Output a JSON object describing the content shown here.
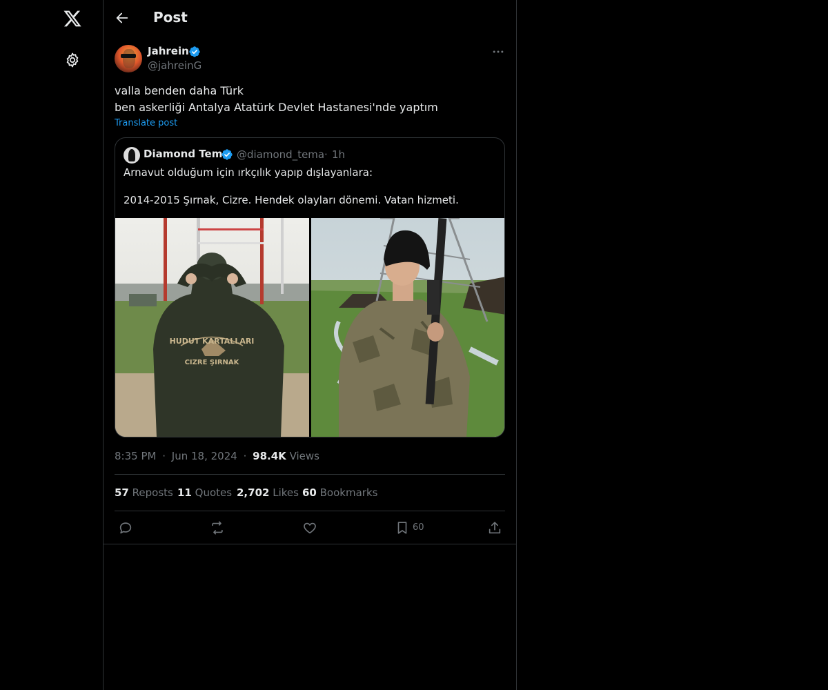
{
  "header": {
    "title": "Post"
  },
  "post": {
    "author_name": "Jahrein",
    "author_handle": "@jahreinG",
    "text": "valla benden daha Türk\nben askerliği Antalya Atatürk Devlet Hastanesi'nde yaptım",
    "translate_label": "Translate post",
    "time": "8:35 PM",
    "date": "Jun 18, 2024",
    "views_count": "98.4K",
    "views_label": " Views",
    "separator": "·"
  },
  "quote": {
    "author_name": "Diamond Tema",
    "author_handle": "@diamond_tema",
    "separator": "·",
    "time": "1h",
    "text": "Arnavut olduğum için ırkçılık yapıp dışlayanlara:\n\n2014-2015 Şırnak, Cizre. Hendek olayları dönemi. Vatan hizmeti.",
    "image_left_caption_top": "HUDUT KARTALLARI",
    "image_left_caption_bottom": "CIZRE ŞIRNAK"
  },
  "stats": {
    "reposts_count": "57",
    "reposts_label": " Reposts",
    "quotes_count": "11",
    "quotes_label": " Quotes",
    "likes_count": "2,702",
    "likes_label": " Likes",
    "bookmarks_count": "60",
    "bookmarks_label": " Bookmarks"
  },
  "actions": {
    "reply_icon": "reply-icon",
    "repost_icon": "repost-icon",
    "like_icon": "heart-icon",
    "bookmark_icon": "bookmark-icon",
    "bookmark_count": "60",
    "share_icon": "share-icon"
  },
  "colors": {
    "background": "#000000",
    "text": "#e7e9ea",
    "muted": "#71767b",
    "accent": "#1d9bf0",
    "border": "#2f3336"
  }
}
